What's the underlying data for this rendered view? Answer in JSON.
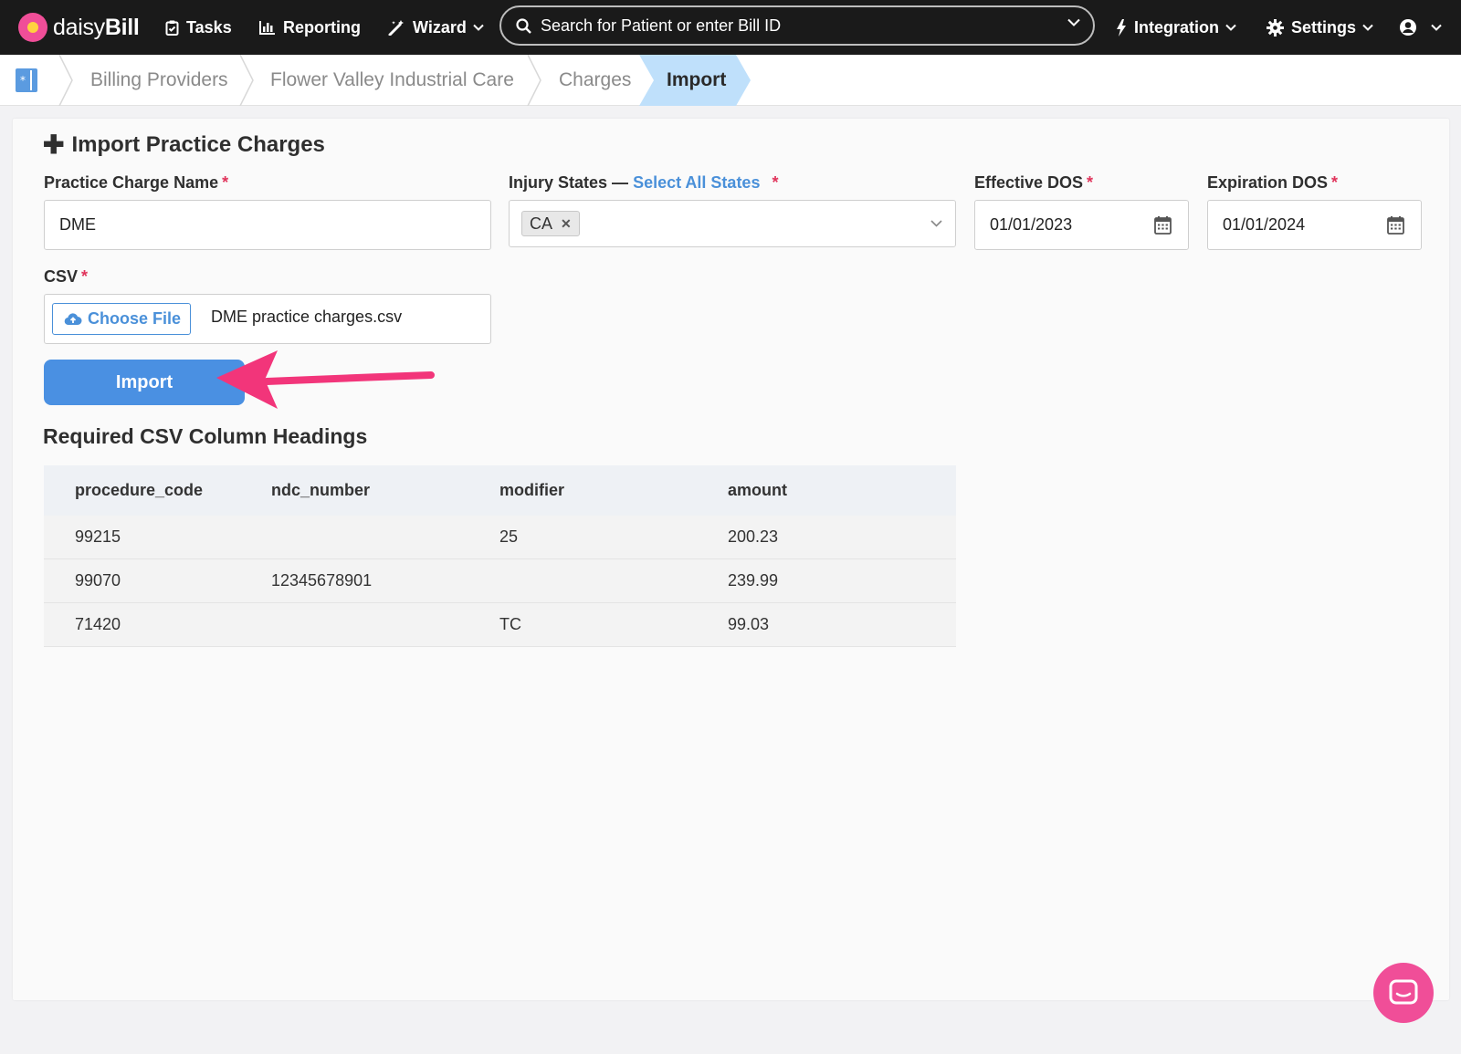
{
  "app": {
    "brand_light": "daisy",
    "brand_bold": "Bill"
  },
  "nav": {
    "tasks": "Tasks",
    "reporting": "Reporting",
    "wizard": "Wizard",
    "search_placeholder": "Search for Patient or enter Bill ID",
    "integration": "Integration",
    "settings": "Settings"
  },
  "breadcrumb": {
    "items": [
      "Billing Providers",
      "Flower Valley Industrial Care",
      "Charges"
    ],
    "active": "Import"
  },
  "form": {
    "title": "Import Practice Charges",
    "charge_name_label": "Practice Charge Name",
    "charge_name_value": "DME",
    "injury_states_label": "Injury States —",
    "select_all_link": "Select All States",
    "selected_state": "CA",
    "effective_label": "Effective DOS",
    "effective_value": "01/01/2023",
    "expiration_label": "Expiration DOS",
    "expiration_value": "01/01/2024",
    "csv_label": "CSV",
    "choose_file": "Choose File",
    "file_name": "DME practice charges.csv",
    "import_button": "Import",
    "required_mark": "*"
  },
  "csv_table": {
    "heading": "Required CSV Column Headings",
    "columns": [
      "procedure_code",
      "ndc_number",
      "modifier",
      "amount"
    ],
    "rows": [
      [
        "99215",
        "",
        "25",
        "200.23"
      ],
      [
        "99070",
        "12345678901",
        "",
        "239.99"
      ],
      [
        "71420",
        "",
        "TC",
        "99.03"
      ]
    ]
  },
  "colors": {
    "accent": "#4a90e2",
    "brand_pink": "#f04e98",
    "topbar": "#1a1a1a",
    "required": "#e0345b",
    "breadcrumb_active": "#bfe0fb"
  }
}
